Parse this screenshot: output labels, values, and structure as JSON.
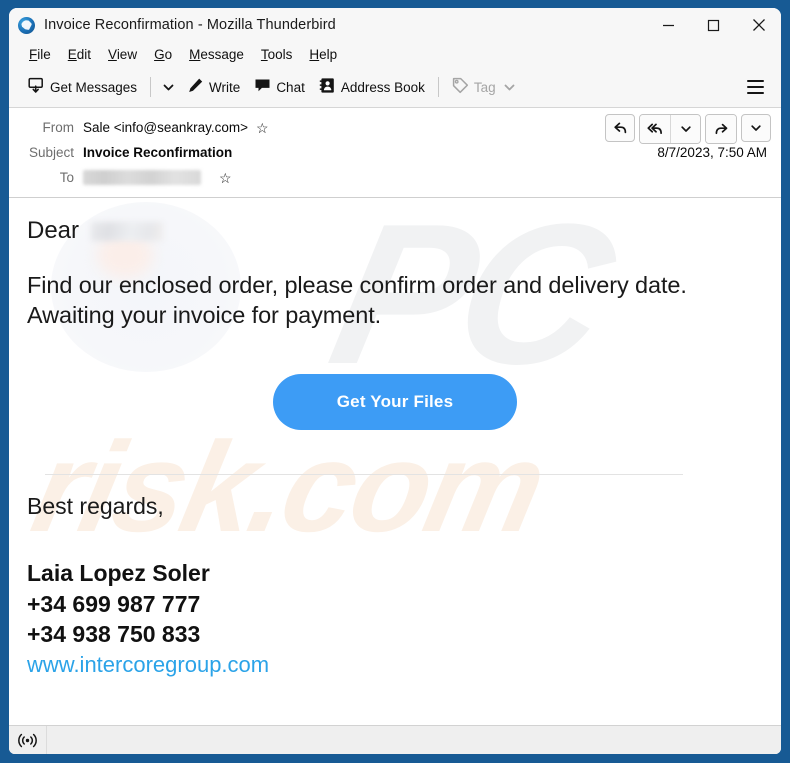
{
  "window": {
    "title": "Invoice Reconfirmation - Mozilla Thunderbird",
    "app_icon": "thunderbird-icon",
    "controls": {
      "minimize": "minimize-icon",
      "maximize": "maximize-icon",
      "close": "close-icon"
    },
    "border_color": "#175a94"
  },
  "menubar": {
    "items": [
      {
        "label": "File",
        "accesskey": "F"
      },
      {
        "label": "Edit",
        "accesskey": "E"
      },
      {
        "label": "View",
        "accesskey": "V"
      },
      {
        "label": "Go",
        "accesskey": "G"
      },
      {
        "label": "Message",
        "accesskey": "M"
      },
      {
        "label": "Tools",
        "accesskey": "T"
      },
      {
        "label": "Help",
        "accesskey": "H"
      }
    ]
  },
  "toolbar": {
    "get_messages": "Get Messages",
    "get_messages_icon": "download-mail-icon",
    "get_messages_caret": "chevron-down-icon",
    "write": "Write",
    "write_icon": "pencil-icon",
    "chat": "Chat",
    "chat_icon": "speech-bubble-icon",
    "address_book": "Address Book",
    "address_book_icon": "contact-card-icon",
    "tag": "Tag",
    "tag_icon": "tag-icon",
    "tag_caret": "chevron-down-icon",
    "tag_disabled": true,
    "app_menu_icon": "hamburger-menu-icon"
  },
  "message_header": {
    "from_label": "From",
    "from_value": "Sale <info@seankray.com>",
    "from_star_icon": "star-icon",
    "subject_label": "Subject",
    "subject_value": "Invoice Reconfirmation",
    "date": "8/7/2023, 7:50 AM",
    "to_label": "To",
    "to_value_redacted": true,
    "to_star_icon": "star-icon",
    "actions": {
      "reply": "reply-icon",
      "reply_all": "reply-all-icon",
      "reply_more": "chevron-down-icon",
      "forward": "forward-icon",
      "more": "chevron-down-icon"
    }
  },
  "body": {
    "greeting": "Dear",
    "greeting_name_redacted": true,
    "paragraph": "Find our enclosed order, please confirm order and delivery date. Awaiting your invoice for payment.",
    "cta_label": "Get Your Files",
    "cta_color": "#3d9cf5",
    "closing": "Best regards,",
    "signature": {
      "name": "Laia Lopez Soler",
      "phone1": "+34 699 987 777",
      "phone2": "+34 938 750 833",
      "website": "www.intercoregroup.com",
      "website_color": "#2ba3e8"
    },
    "watermarks": {
      "primary": "PC",
      "secondary": "risk.com"
    }
  },
  "statusbar": {
    "connection_icon": "broadcast-signal-icon",
    "text": ""
  }
}
